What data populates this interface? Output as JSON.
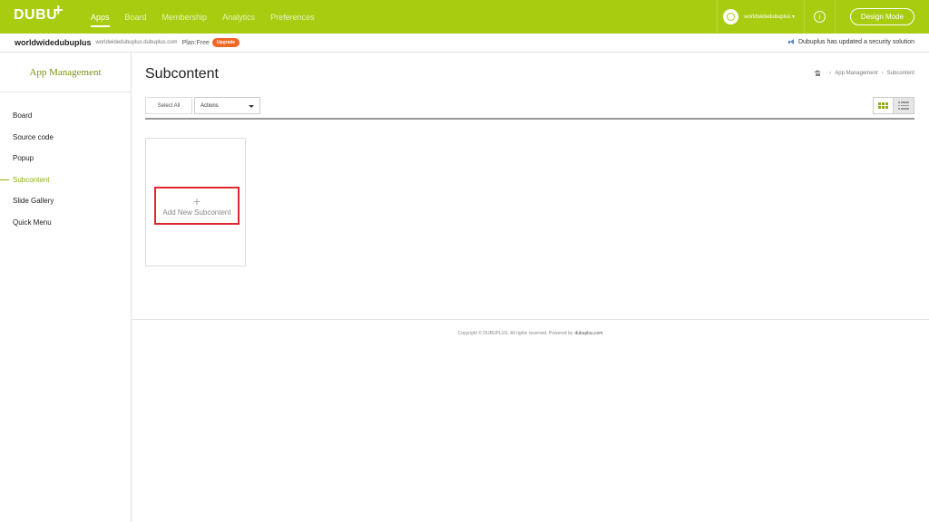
{
  "topbar": {
    "logo": "DUBU",
    "logo_plus": "+",
    "nav": [
      {
        "label": "Apps",
        "active": true
      },
      {
        "label": "Board",
        "active": false
      },
      {
        "label": "Membership",
        "active": false
      },
      {
        "label": "Analytics",
        "active": false
      },
      {
        "label": "Preferences",
        "active": false
      }
    ],
    "user": "worldwidedubuplus ▾",
    "info": "i",
    "design_mode": "Design Mode",
    "accent": "#a8cc10"
  },
  "subbar": {
    "site_name": "worldwidedubuplus",
    "site_url": "worldwidedubuplus.dubuplus.com",
    "plan": "Plan:Free",
    "upgrade": "Upgrade",
    "notice": "Dubuplus has updated a security solution"
  },
  "sidebar": {
    "title": "App Management",
    "items": [
      {
        "label": "Board",
        "active": false
      },
      {
        "label": "Source code",
        "active": false
      },
      {
        "label": "Popup",
        "active": false
      },
      {
        "label": "Subcontent",
        "active": true
      },
      {
        "label": "Slide Gallery",
        "active": false
      },
      {
        "label": "Quick Menu",
        "active": false
      }
    ]
  },
  "main": {
    "title": "Subcontent",
    "breadcrumb": [
      "App Management",
      "Subcontent"
    ],
    "select_all": "Select All",
    "actions": "Actions",
    "add_plus": "+",
    "add_label": "Add New Subcontent"
  },
  "footer": {
    "text": "Copyright © DUBUPLUS. All rights reserved. Powered by",
    "link": "dubuplus.com"
  }
}
